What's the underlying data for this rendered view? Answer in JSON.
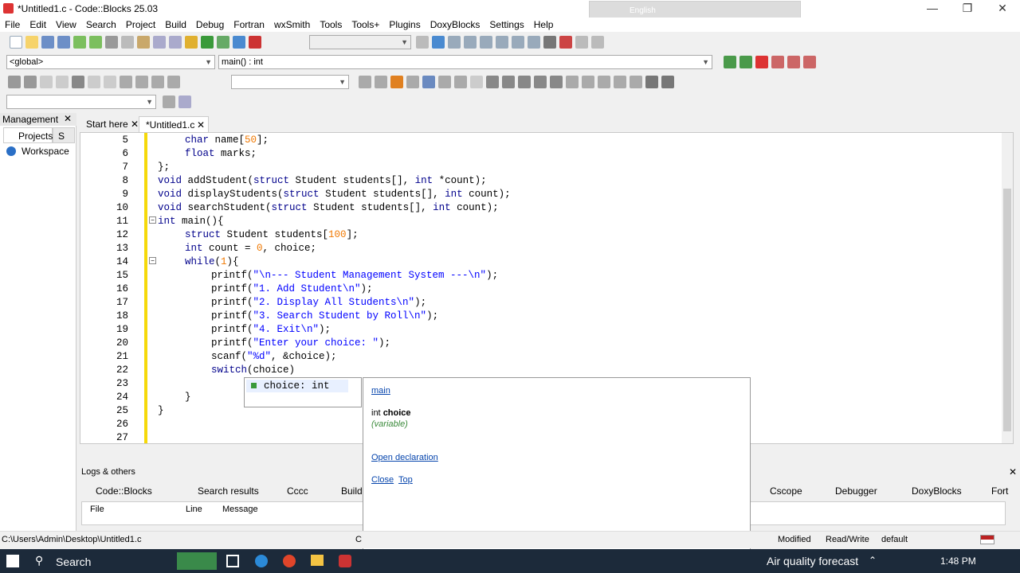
{
  "window": {
    "title": "*Untitled1.c - Code::Blocks 25.03"
  },
  "ime": {
    "lang": "English"
  },
  "menu": [
    "File",
    "Edit",
    "View",
    "Search",
    "Project",
    "Build",
    "Debug",
    "Fortran",
    "wxSmith",
    "Tools",
    "Tools+",
    "Plugins",
    "DoxyBlocks",
    "Settings",
    "Help"
  ],
  "scope": {
    "global": "<global>",
    "func": "main() : int"
  },
  "left_panel": {
    "title": "Management",
    "tab": "Projects",
    "tab2": "S",
    "tree_root": "Workspace"
  },
  "editor_tabs": [
    {
      "label": "Start here"
    },
    {
      "label": "*Untitled1.c"
    }
  ],
  "code_lines": [
    {
      "n": "5"
    },
    {
      "n": "6"
    },
    {
      "n": "7"
    },
    {
      "n": "8"
    },
    {
      "n": "9"
    },
    {
      "n": "10"
    },
    {
      "n": "11"
    },
    {
      "n": "12"
    },
    {
      "n": "13"
    },
    {
      "n": "14"
    },
    {
      "n": "15"
    },
    {
      "n": "16"
    },
    {
      "n": "17"
    },
    {
      "n": "18"
    },
    {
      "n": "19"
    },
    {
      "n": "20"
    },
    {
      "n": "21"
    },
    {
      "n": "22"
    },
    {
      "n": "23"
    },
    {
      "n": "24"
    },
    {
      "n": "25"
    },
    {
      "n": "26"
    },
    {
      "n": "27"
    }
  ],
  "code": {
    "l5a": "char",
    "l5b": " name[",
    "l5c": "50",
    "l5d": "];",
    "l6a": "float",
    "l6b": " marks;",
    "l7": "};",
    "l8a": "void",
    "l8b": " addStudent(",
    "l8c": "struct",
    "l8d": " Student students[], ",
    "l8e": "int",
    "l8f": " *count);",
    "l9a": "void",
    "l9b": " displayStudents(",
    "l9c": "struct",
    "l9d": " Student students[], ",
    "l9e": "int",
    "l9f": " count);",
    "l10a": "void",
    "l10b": " searchStudent(",
    "l10c": "struct",
    "l10d": " Student students[], ",
    "l10e": "int",
    "l10f": " count);",
    "l11a": "int",
    "l11b": " main(){",
    "l12a": "struct",
    "l12b": " Student students[",
    "l12c": "100",
    "l12d": "];",
    "l13a": "int",
    "l13b": " count = ",
    "l13c": "0",
    "l13d": ", choice;",
    "l14a": "while",
    "l14b": "(",
    "l14c": "1",
    "l14d": "){",
    "l15a": "printf(",
    "l15b": "\"\\n--- Student Management System ---\\n\"",
    "l15c": ");",
    "l16a": "printf(",
    "l16b": "\"1. Add Student\\n\"",
    "l16c": ");",
    "l17a": "printf(",
    "l17b": "\"2. Display All Students\\n\"",
    "l17c": ");",
    "l18a": "printf(",
    "l18b": "\"3. Search Student by Roll\\n\"",
    "l18c": ");",
    "l19a": "printf(",
    "l19b": "\"4. Exit\\n\"",
    "l19c": ");",
    "l20a": "printf(",
    "l20b": "\"Enter your choice: \"",
    "l20c": ");",
    "l21a": "scanf(",
    "l21b": "\"%d\"",
    "l21c": ", &choice);",
    "l22a": "switch",
    "l22b": "(choice)",
    "l24": "}",
    "l25": "}"
  },
  "autocomplete": {
    "item": "choice: int"
  },
  "tooltip": {
    "scope": "main",
    "decl_type": "int ",
    "decl_name": "choice",
    "kind": "(variable)",
    "open": "Open declaration",
    "close": "Close",
    "top": "Top"
  },
  "logs": {
    "title": "Logs & others",
    "tabs": [
      "Code::Blocks",
      "Search results",
      "Cccc",
      "Build",
      "Cscope",
      "Debugger",
      "DoxyBlocks",
      "Fort"
    ],
    "columns": [
      "File",
      "Line",
      "Message"
    ]
  },
  "status": {
    "path": "C:\\Users\\Admin\\Desktop\\Untitled1.c",
    "partial": "C",
    "modified": "Modified",
    "rw": "Read/Write",
    "profile": "default"
  },
  "taskbar": {
    "search": "Search",
    "weather": "Air quality forecast",
    "time": "1:48 PM"
  },
  "colors": {
    "keyword": "#00008b",
    "string": "#0000ff",
    "number": "#f07800",
    "margin": "#f5d90a"
  }
}
